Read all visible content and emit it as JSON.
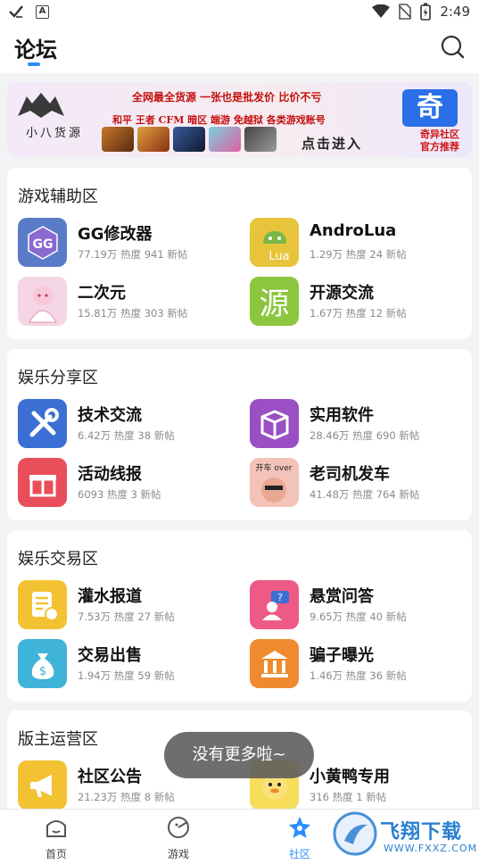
{
  "status_bar": {
    "time": "2:49"
  },
  "header": {
    "title": "论坛"
  },
  "banner": {
    "left_logo_text": "小八货源",
    "slogan": "全网最全货源  一张也是批发价  比价不亏",
    "games_line": "和平  王者  CFM  暗区  端游  免越狱  各类游戏账号",
    "enter_text": "点击进入",
    "right_logo": "奇",
    "right_text_1": "奇异社区",
    "right_text_2": "官方推荐"
  },
  "sections": [
    {
      "title": "游戏辅助区",
      "boards": [
        {
          "name": "GG修改器",
          "stats": "77.19万 热度 941 新帖"
        },
        {
          "name": "AndroLua",
          "stats": "1.29万 热度 24 新帖"
        },
        {
          "name": "二次元",
          "stats": "15.81万 热度 303 新帖"
        },
        {
          "name": "开源交流",
          "stats": "1.67万 热度 12 新帖"
        }
      ]
    },
    {
      "title": "娱乐分享区",
      "boards": [
        {
          "name": "技术交流",
          "stats": "6.42万 热度 38 新帖"
        },
        {
          "name": "实用软件",
          "stats": "28.46万 热度 690 新帖"
        },
        {
          "name": "活动线报",
          "stats": "6093 热度 3 新帖"
        },
        {
          "name": "老司机发车",
          "stats": "41.48万 热度 764 新帖"
        }
      ]
    },
    {
      "title": "娱乐交易区",
      "boards": [
        {
          "name": "灌水报道",
          "stats": "7.53万 热度 27 新帖"
        },
        {
          "name": "悬赏问答",
          "stats": "9.65万 热度 40 新帖"
        },
        {
          "name": "交易出售",
          "stats": "1.94万 热度 59 新帖"
        },
        {
          "name": "骗子曝光",
          "stats": "1.46万 热度 36 新帖"
        }
      ]
    },
    {
      "title": "版主运营区",
      "boards": [
        {
          "name": "社区公告",
          "stats": "21.23万 热度 8 新帖"
        },
        {
          "name": "小黄鸭专用",
          "stats": "316 热度 1 新帖"
        }
      ]
    }
  ],
  "icons": {
    "gg": "GG",
    "lua": "Lua",
    "source": "源",
    "kaiche": "开车 over"
  },
  "toast": "没有更多啦~",
  "tabs": [
    {
      "label": "首页"
    },
    {
      "label": "游戏"
    },
    {
      "label": "社区"
    }
  ],
  "watermark": {
    "brand": "飞翔下载",
    "url": "WWW.FXXZ.COM"
  },
  "colors": {
    "accent": "#2a8cff"
  }
}
